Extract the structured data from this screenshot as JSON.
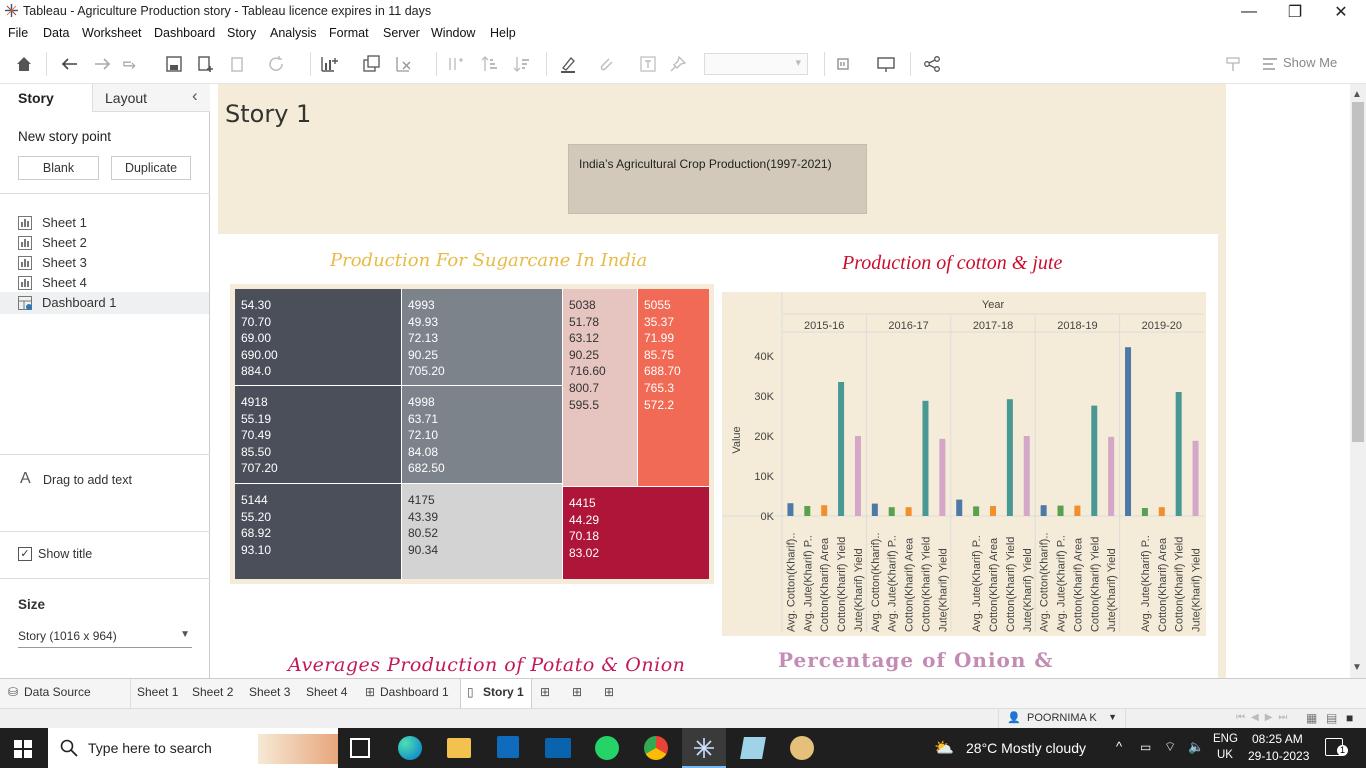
{
  "window": {
    "title": "Tableau - Agriculture Production story - Tableau licence expires in 11 days",
    "minimize": "—",
    "maximize": "❐",
    "close": "✕"
  },
  "menu": [
    "File",
    "Data",
    "Worksheet",
    "Dashboard",
    "Story",
    "Analysis",
    "Format",
    "Server",
    "Window",
    "Help"
  ],
  "toolbar": {
    "show_me": "Show Me"
  },
  "sidebar": {
    "tab_story": "Story",
    "tab_layout": "Layout",
    "collapse": "‹",
    "new_story_point": "New story point",
    "blank": "Blank",
    "duplicate": "Duplicate",
    "sheets": [
      {
        "label": "Sheet 1",
        "icon": "sheet-icon"
      },
      {
        "label": "Sheet 2",
        "icon": "sheet-icon"
      },
      {
        "label": "Sheet 3",
        "icon": "sheet-icon"
      },
      {
        "label": "Sheet 4",
        "icon": "sheet-icon"
      },
      {
        "label": "Dashboard 1",
        "icon": "dashboard-icon"
      }
    ],
    "drag_text": "Drag to add text",
    "text_icon": "A",
    "show_title": "Show title",
    "size_label": "Size",
    "size_value": "Story (1016 x 964)"
  },
  "story": {
    "title": "Story 1",
    "caption": "India’s Agricultural Crop Production(1997-2021)",
    "treemap_title": "Production For Sugarcane In India",
    "bar_title": "Production of cotton & jute",
    "bottom_left_title": "Averages  Production of Potato & Onion",
    "bottom_right_title": "Percentage of Onion &"
  },
  "treemap": [
    {
      "lines": [
        "54.30",
        "70.70",
        "69.00",
        "690.00",
        "884.0"
      ],
      "color": "#4a4f5a"
    },
    {
      "lines": [
        "4918",
        "55.19",
        "70.49",
        "85.50",
        "707.20"
      ],
      "color": "#4a4f5a"
    },
    {
      "lines": [
        "5144",
        "55.20",
        "68.92",
        "93.10"
      ],
      "color": "#4a4f5a"
    },
    {
      "lines": [
        "4993",
        "49.93",
        "72.13",
        "90.25",
        "705.20"
      ],
      "color": "#7d838b"
    },
    {
      "lines": [
        "4998",
        "63.71",
        "72.10",
        "84.08",
        "682.50"
      ],
      "color": "#7d838b"
    },
    {
      "lines": [
        "4175",
        "43.39",
        "80.52",
        "90.34"
      ],
      "color": "#d3d3d3"
    },
    {
      "lines": [
        "5038",
        "51.78",
        "63.12",
        "90.25",
        "716.60",
        "800.7",
        "595.5"
      ],
      "color": "#e6c5c0"
    },
    {
      "lines": [
        "5055",
        "35.37",
        "71.99",
        "85.75",
        "688.70",
        "765.3",
        "572.2"
      ],
      "color": "#f06a55"
    },
    {
      "lines": [
        "4415",
        "44.29",
        "70.18",
        "83.02"
      ],
      "color": "#ae1538"
    }
  ],
  "chart_data": {
    "type": "bar",
    "title": "Production of cotton & jute",
    "header": "Year",
    "ylabel": "Value",
    "ylim": [
      0,
      45000
    ],
    "yticks": [
      "40K",
      "30K",
      "20K",
      "10K",
      "0K"
    ],
    "categories": [
      "2015-16",
      "2016-17",
      "2017-18",
      "2018-19",
      "2019-20"
    ],
    "measures_per_year": [
      [
        "Avg. Cotton(Kharif)..",
        "Avg. Jute(Kharif) P..",
        "Cotton(Kharif) Area",
        "Cotton(Kharif) Yield",
        "Jute(Kharif) Yield"
      ],
      [
        "Avg. Cotton(Kharif)..",
        "Avg. Jute(Kharif) P..",
        "Cotton(Kharif) Area",
        "Cotton(Kharif) Yield",
        "Jute(Kharif) Yield"
      ],
      [
        "Avg. Jute(Kharif) P..",
        "Cotton(Kharif) Area",
        "Cotton(Kharif) Yield",
        "Jute(Kharif) Yield"
      ],
      [
        "Avg. Cotton(Kharif)..",
        "Avg. Jute(Kharif) P..",
        "Cotton(Kharif) Area",
        "Cotton(Kharif) Yield",
        "Jute(Kharif) Yield"
      ],
      [
        "Avg. Jute(Kharif) P..",
        "Cotton(Kharif) Area",
        "Cotton(Kharif) Yield",
        "Jute(Kharif) Yield"
      ]
    ],
    "series": [
      {
        "values": [
          3200,
          3100,
          4100,
          2700,
          42200
        ]
      },
      {
        "values": [
          2500,
          2200,
          2400,
          2600,
          2000
        ]
      },
      {
        "values": [
          2700,
          2200,
          2500,
          2600,
          2200
        ]
      },
      {
        "values": [
          33500,
          28800,
          29200,
          27600,
          31000
        ]
      },
      {
        "values": [
          20000,
          19300,
          20000,
          19800,
          18800
        ]
      }
    ],
    "colors": [
      "#4e79a7",
      "#59a14f",
      "#f28e2b",
      "#499894",
      "#d4a6c8"
    ]
  },
  "tabs": [
    "Data Source",
    "Sheet 1",
    "Sheet 2",
    "Sheet 3",
    "Sheet 4",
    "Dashboard 1",
    "Story 1"
  ],
  "status": {
    "user": "POORNIMA K"
  },
  "taskbar": {
    "search_placeholder": "Type here to search",
    "weather": "28°C  Mostly cloudy",
    "lang1": "ENG",
    "lang2": "UK",
    "time": "08:25 AM",
    "date": "29-10-2023",
    "notif": "1"
  }
}
